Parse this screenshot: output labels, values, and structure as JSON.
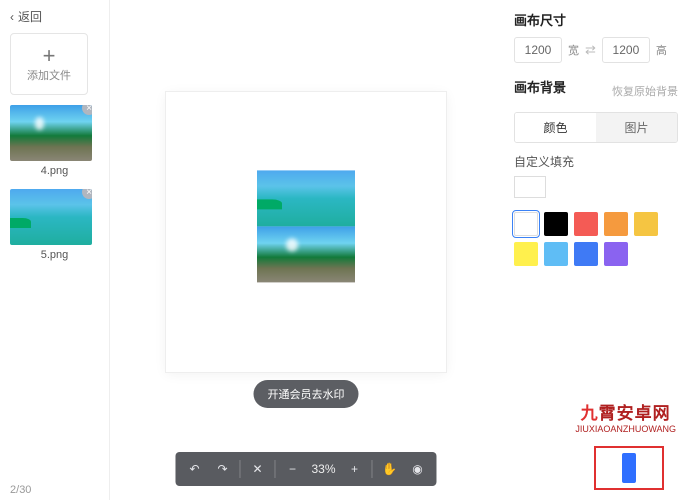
{
  "sidebar": {
    "back_label": "返回",
    "add_label": "添加文件",
    "thumbs": [
      {
        "name": "4.png"
      },
      {
        "name": "5.png"
      }
    ],
    "page_current": "2",
    "page_sep": "/",
    "page_total": "30"
  },
  "canvas": {
    "watermark_pill": "开通会员去水印",
    "zoom_label": "33%"
  },
  "panel": {
    "size_header": "画布尺寸",
    "width_value": "1200",
    "width_label": "宽",
    "height_value": "1200",
    "height_label": "高",
    "bg_header": "画布背景",
    "restore_label": "恢复原始背景",
    "tab_color": "颜色",
    "tab_image": "图片",
    "custom_fill": "自定义填充",
    "swatches": [
      {
        "color": "#ffffff",
        "selected": true,
        "border": true
      },
      {
        "color": "#000000"
      },
      {
        "color": "#f45b55"
      },
      {
        "color": "#f59a3e"
      },
      {
        "color": "#f5c542"
      },
      {
        "color": "#fff04d"
      },
      {
        "color": "#5fbdf5"
      },
      {
        "color": "#3f7af5"
      },
      {
        "color": "#8a63f0"
      }
    ]
  },
  "logo": {
    "text_main": "霄安卓网",
    "text_sub": "JIUXIAOANZHUOWANG"
  }
}
